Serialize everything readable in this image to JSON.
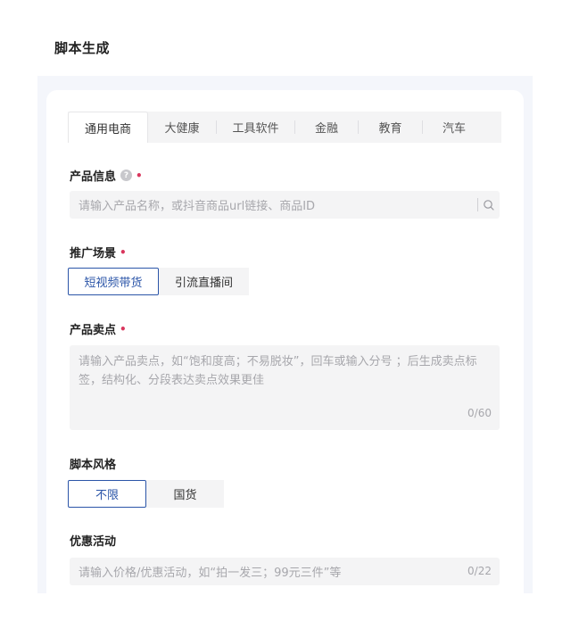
{
  "page": {
    "title": "脚本生成"
  },
  "tabs": [
    {
      "label": "通用电商",
      "active": true
    },
    {
      "label": "大健康",
      "active": false
    },
    {
      "label": "工具软件",
      "active": false
    },
    {
      "label": "金融",
      "active": false
    },
    {
      "label": "教育",
      "active": false
    },
    {
      "label": "汽车",
      "active": false
    }
  ],
  "product_info": {
    "label": "产品信息",
    "help_icon": "?",
    "required_mark": "•",
    "placeholder": "请输入产品名称，或抖音商品url链接、商品ID"
  },
  "promo_scene": {
    "label": "推广场景",
    "required_mark": "•",
    "options": [
      "短视频带货",
      "引流直播间"
    ],
    "selected": "短视频带货"
  },
  "selling_points": {
    "label": "产品卖点",
    "required_mark": "•",
    "placeholder": "请输入产品卖点，如“饱和度高；不易脱妆”，回车或输入分号 ；后生成卖点标签，结构化、分段表达卖点效果更佳",
    "counter": "0/60"
  },
  "script_style": {
    "label": "脚本风格",
    "options": [
      "不限",
      "国货"
    ],
    "selected": "不限"
  },
  "discount": {
    "label": "优惠活动",
    "placeholder": "请输入价格/优惠活动，如“拍一发三；99元三件”等",
    "counter": "0/22"
  },
  "colors": {
    "accent": "#2b55a8",
    "required": "#d9365d",
    "panel_bg": "#f4f6fb",
    "input_bg": "#f4f4f5"
  }
}
